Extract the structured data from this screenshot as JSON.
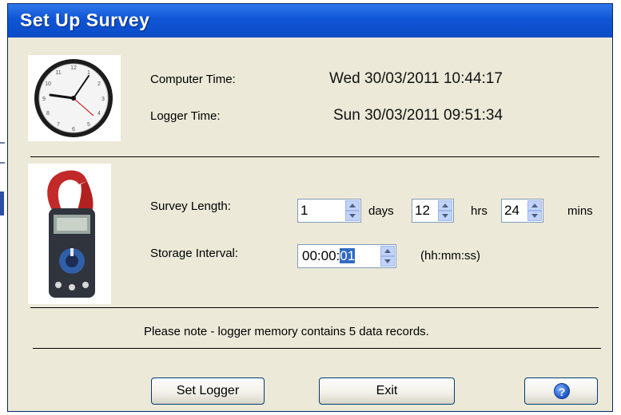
{
  "window": {
    "title": "Set Up Survey"
  },
  "time": {
    "computer_label": "Computer Time:",
    "computer_value": "Wed 30/03/2011 10:44:17",
    "logger_label": "Logger Time:",
    "logger_value": "Sun 30/03/2011 09:51:34"
  },
  "survey": {
    "length_label": "Survey Length:",
    "days_value": "1",
    "days_unit": "days",
    "hrs_value": "12",
    "hrs_unit": "hrs",
    "mins_value": "24",
    "mins_unit": "mins",
    "interval_label": "Storage Interval:",
    "interval_prefix": "00:00:",
    "interval_selected": "01",
    "interval_hint": "(hh:mm:ss)"
  },
  "note": "Please note - logger memory contains 5 data records.",
  "buttons": {
    "set_logger": "Set Logger",
    "exit": "Exit",
    "help_glyph": "?"
  },
  "icons": {
    "clock": "clock-icon",
    "meter": "clamp-meter-icon",
    "help": "help-icon"
  },
  "colors": {
    "titlebar": "#0b4bc6",
    "dialog_bg": "#ece9d8",
    "selection": "#316ac5"
  }
}
